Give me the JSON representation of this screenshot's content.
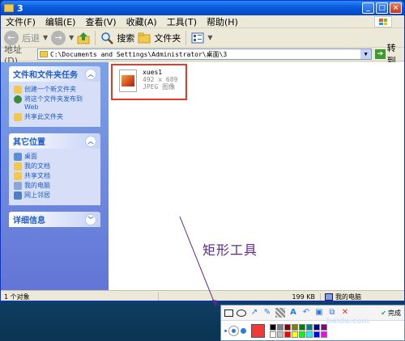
{
  "window": {
    "title": "3",
    "buttons": [
      "_",
      "□",
      "×"
    ]
  },
  "menubar": {
    "items": [
      "文件(F)",
      "编辑(E)",
      "查看(V)",
      "收藏(A)",
      "工具(T)",
      "帮助(H)"
    ]
  },
  "toolbar": {
    "back": "后退",
    "forward_arrow": "→",
    "back_arrow": "←",
    "search": "搜索",
    "folders": "文件夹"
  },
  "address": {
    "label": "地址(D)",
    "path": "C:\\Documents and Settings\\Administrator\\桌面\\3",
    "go": "转到"
  },
  "tasks": {
    "title": "文件和文件夹任务",
    "items": [
      "创建一个新文件夹",
      "将这个文件夹发布到 Web",
      "共享此文件夹"
    ]
  },
  "places": {
    "title": "其它位置",
    "items": [
      "桌面",
      "我的文档",
      "共享文档",
      "我的电脑",
      "网上邻居"
    ]
  },
  "details": {
    "title": "详细信息"
  },
  "file": {
    "name": "xues1",
    "dims": "492 x 689",
    "type": "JPEG 图像"
  },
  "annotation": "矩形工具",
  "status": {
    "objects": "1 个对象",
    "size": "199 KB",
    "location": "我的电脑"
  },
  "snip": {
    "done": "完成",
    "primary_color": "#f03a3a",
    "palette": [
      "#000000",
      "#808080",
      "#800000",
      "#808000",
      "#008000",
      "#008080",
      "#000080",
      "#800080",
      "#ffffff",
      "#c0c0c0",
      "#ff0000",
      "#ffff00",
      "#00ff00",
      "#00ffff",
      "#0000ff",
      "#ff00ff"
    ]
  },
  "watermark": "baidu.com"
}
